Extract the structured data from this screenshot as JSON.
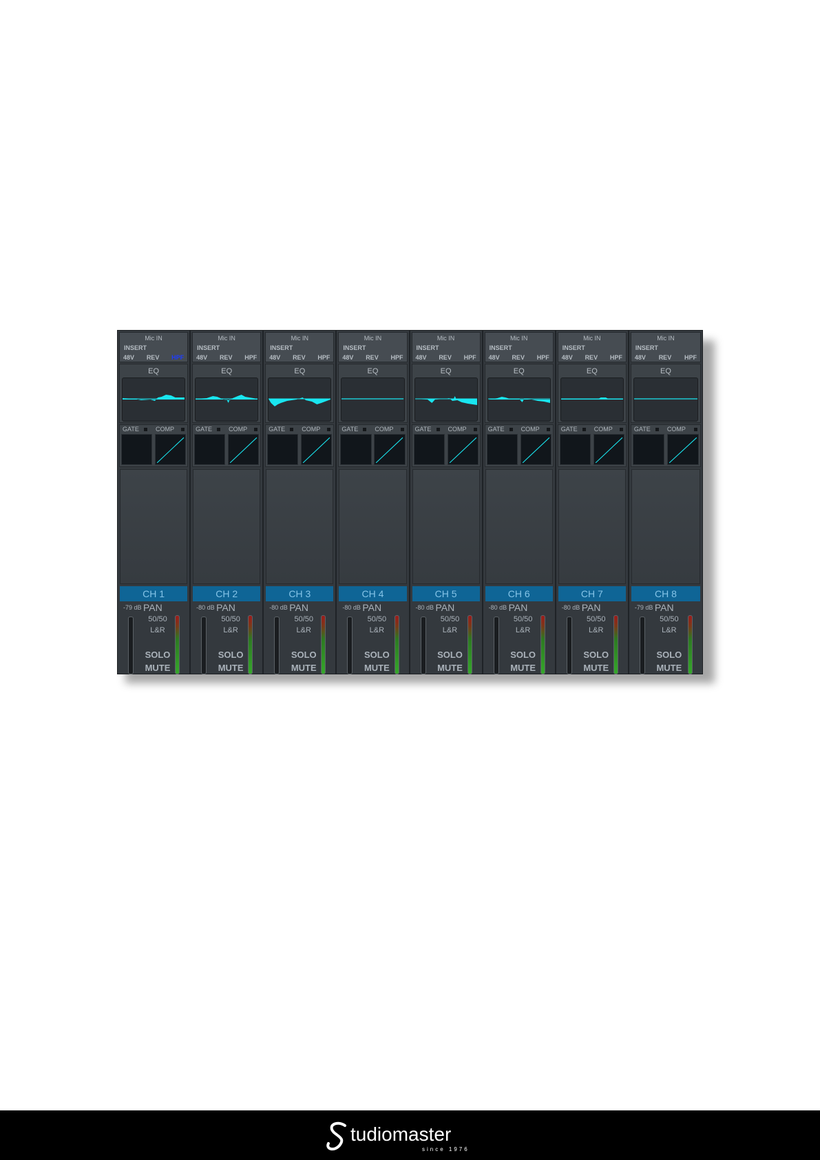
{
  "input_panel": {
    "title": "Mic IN",
    "insert_label": "INSERT",
    "phantom_label": "48V",
    "reverse_label": "REV",
    "hpf_label": "HPF"
  },
  "eq_label": "EQ",
  "gate_label": "GATE",
  "comp_label": "COMP",
  "pan_label": "PAN",
  "solo_label": "SOLO",
  "mute_label": "MUTE",
  "colors": {
    "eq_curve": "#19e6f0",
    "channel_label_bg": "#0f6596",
    "hpf_active": "#1e3cff",
    "background": "#2b3035"
  },
  "channels": [
    {
      "name": "CH 1",
      "gain": "-79 dB",
      "pan": "50/50",
      "route": "L&R",
      "hpf_active": true
    },
    {
      "name": "CH 2",
      "gain": "-80 dB",
      "pan": "50/50",
      "route": "L&R",
      "hpf_active": false
    },
    {
      "name": "CH 3",
      "gain": "-80 dB",
      "pan": "50/50",
      "route": "L&R",
      "hpf_active": false
    },
    {
      "name": "CH 4",
      "gain": "-80 dB",
      "pan": "50/50",
      "route": "L&R",
      "hpf_active": false
    },
    {
      "name": "CH 5",
      "gain": "-80 dB",
      "pan": "50/50",
      "route": "L&R",
      "hpf_active": false
    },
    {
      "name": "CH 6",
      "gain": "-80 dB",
      "pan": "50/50",
      "route": "L&R",
      "hpf_active": false
    },
    {
      "name": "CH 7",
      "gain": "-80 dB",
      "pan": "50/50",
      "route": "L&R",
      "hpf_active": false
    },
    {
      "name": "CH 8",
      "gain": "-79 dB",
      "pan": "50/50",
      "route": "L&R",
      "hpf_active": false
    }
  ],
  "footer": {
    "brand": "Studiomaster",
    "tagline": "since 1976"
  }
}
